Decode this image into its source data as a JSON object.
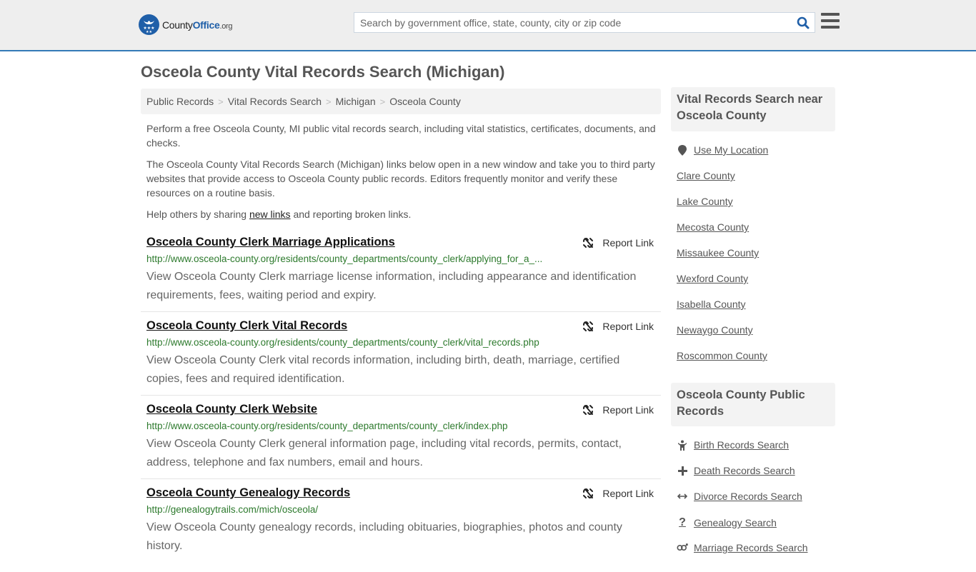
{
  "header": {
    "logo": {
      "county": "County",
      "office": "Office",
      "org": ".org"
    },
    "search_placeholder": "Search by government office, state, county, city or zip code",
    "search_value": "",
    "icons": {
      "search": "search-icon",
      "menu": "hamburger-menu-icon"
    }
  },
  "page_title": "Osceola County Vital Records Search (Michigan)",
  "breadcrumb": [
    "Public Records",
    "Vital Records Search",
    "Michigan",
    "Osceola County"
  ],
  "intro": {
    "p1": "Perform a free Osceola County, MI public vital records search, including vital statistics, certificates, documents, and checks.",
    "p2": "The Osceola County Vital Records Search (Michigan) links below open in a new window and take you to third party websites that provide access to Osceola County public records. Editors frequently monitor and verify these resources on a routine basis.",
    "p3_before": "Help others by sharing ",
    "p3_link": "new links",
    "p3_after": " and reporting broken links."
  },
  "report_label": "Report Link",
  "results": [
    {
      "title": "Osceola County Clerk Marriage Applications",
      "url": "http://www.osceola-county.org/residents/county_departments/county_clerk/applying_for_a_...",
      "desc": "View Osceola County Clerk marriage license information, including appearance and identification requirements, fees, waiting period and expiry."
    },
    {
      "title": "Osceola County Clerk Vital Records",
      "url": "http://www.osceola-county.org/residents/county_departments/county_clerk/vital_records.php",
      "desc": "View Osceola County Clerk vital records information, including birth, death, marriage, certified copies, fees and required identification."
    },
    {
      "title": "Osceola County Clerk Website",
      "url": "http://www.osceola-county.org/residents/county_departments/county_clerk/index.php",
      "desc": "View Osceola County Clerk general information page, including vital records, permits, contact, address, telephone and fax numbers, email and hours."
    },
    {
      "title": "Osceola County Genealogy Records",
      "url": "http://genealogytrails.com/mich/osceola/",
      "desc": "View Osceola County genealogy records, including obituaries, biographies, photos and county history."
    }
  ],
  "sidebar": {
    "nearby_heading": "Vital Records Search near Osceola County",
    "use_location": "Use My Location",
    "nearby": [
      "Clare County",
      "Lake County",
      "Mecosta County",
      "Missaukee County",
      "Wexford County",
      "Isabella County",
      "Newaygo County",
      "Roscommon County"
    ],
    "public_heading": "Osceola County Public Records",
    "public": [
      {
        "label": "Birth Records Search",
        "icon": "child-icon"
      },
      {
        "label": "Death Records Search",
        "icon": "plus-icon"
      },
      {
        "label": "Divorce Records Search",
        "icon": "arrows-horizontal-icon"
      },
      {
        "label": "Genealogy Search",
        "icon": "question-icon"
      },
      {
        "label": "Marriage Records Search",
        "icon": "gender-icon"
      }
    ]
  },
  "colors": {
    "brand_blue": "#1f5fa8",
    "header_border": "#337ab7",
    "url_green": "#2d7a2d"
  }
}
